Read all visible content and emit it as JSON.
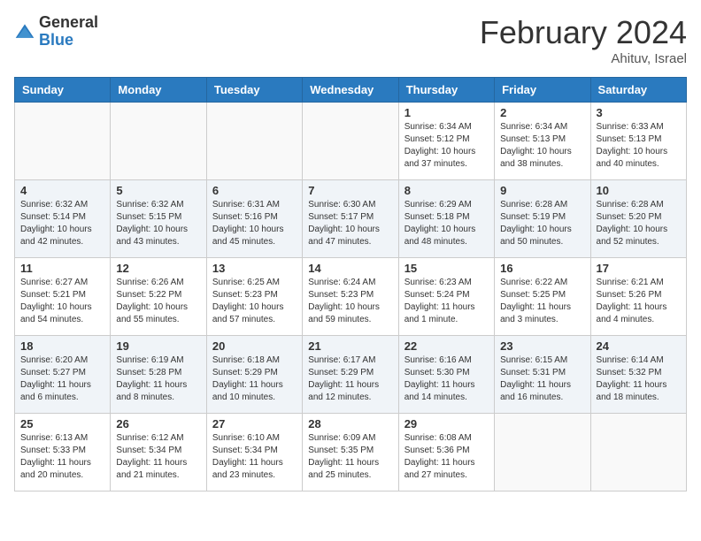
{
  "logo": {
    "general": "General",
    "blue": "Blue"
  },
  "title": "February 2024",
  "location": "Ahituv, Israel",
  "headers": [
    "Sunday",
    "Monday",
    "Tuesday",
    "Wednesday",
    "Thursday",
    "Friday",
    "Saturday"
  ],
  "weeks": [
    [
      {
        "day": "",
        "info": ""
      },
      {
        "day": "",
        "info": ""
      },
      {
        "day": "",
        "info": ""
      },
      {
        "day": "",
        "info": ""
      },
      {
        "day": "1",
        "info": "Sunrise: 6:34 AM\nSunset: 5:12 PM\nDaylight: 10 hours\nand 37 minutes."
      },
      {
        "day": "2",
        "info": "Sunrise: 6:34 AM\nSunset: 5:13 PM\nDaylight: 10 hours\nand 38 minutes."
      },
      {
        "day": "3",
        "info": "Sunrise: 6:33 AM\nSunset: 5:13 PM\nDaylight: 10 hours\nand 40 minutes."
      }
    ],
    [
      {
        "day": "4",
        "info": "Sunrise: 6:32 AM\nSunset: 5:14 PM\nDaylight: 10 hours\nand 42 minutes."
      },
      {
        "day": "5",
        "info": "Sunrise: 6:32 AM\nSunset: 5:15 PM\nDaylight: 10 hours\nand 43 minutes."
      },
      {
        "day": "6",
        "info": "Sunrise: 6:31 AM\nSunset: 5:16 PM\nDaylight: 10 hours\nand 45 minutes."
      },
      {
        "day": "7",
        "info": "Sunrise: 6:30 AM\nSunset: 5:17 PM\nDaylight: 10 hours\nand 47 minutes."
      },
      {
        "day": "8",
        "info": "Sunrise: 6:29 AM\nSunset: 5:18 PM\nDaylight: 10 hours\nand 48 minutes."
      },
      {
        "day": "9",
        "info": "Sunrise: 6:28 AM\nSunset: 5:19 PM\nDaylight: 10 hours\nand 50 minutes."
      },
      {
        "day": "10",
        "info": "Sunrise: 6:28 AM\nSunset: 5:20 PM\nDaylight: 10 hours\nand 52 minutes."
      }
    ],
    [
      {
        "day": "11",
        "info": "Sunrise: 6:27 AM\nSunset: 5:21 PM\nDaylight: 10 hours\nand 54 minutes."
      },
      {
        "day": "12",
        "info": "Sunrise: 6:26 AM\nSunset: 5:22 PM\nDaylight: 10 hours\nand 55 minutes."
      },
      {
        "day": "13",
        "info": "Sunrise: 6:25 AM\nSunset: 5:23 PM\nDaylight: 10 hours\nand 57 minutes."
      },
      {
        "day": "14",
        "info": "Sunrise: 6:24 AM\nSunset: 5:23 PM\nDaylight: 10 hours\nand 59 minutes."
      },
      {
        "day": "15",
        "info": "Sunrise: 6:23 AM\nSunset: 5:24 PM\nDaylight: 11 hours\nand 1 minute."
      },
      {
        "day": "16",
        "info": "Sunrise: 6:22 AM\nSunset: 5:25 PM\nDaylight: 11 hours\nand 3 minutes."
      },
      {
        "day": "17",
        "info": "Sunrise: 6:21 AM\nSunset: 5:26 PM\nDaylight: 11 hours\nand 4 minutes."
      }
    ],
    [
      {
        "day": "18",
        "info": "Sunrise: 6:20 AM\nSunset: 5:27 PM\nDaylight: 11 hours\nand 6 minutes."
      },
      {
        "day": "19",
        "info": "Sunrise: 6:19 AM\nSunset: 5:28 PM\nDaylight: 11 hours\nand 8 minutes."
      },
      {
        "day": "20",
        "info": "Sunrise: 6:18 AM\nSunset: 5:29 PM\nDaylight: 11 hours\nand 10 minutes."
      },
      {
        "day": "21",
        "info": "Sunrise: 6:17 AM\nSunset: 5:29 PM\nDaylight: 11 hours\nand 12 minutes."
      },
      {
        "day": "22",
        "info": "Sunrise: 6:16 AM\nSunset: 5:30 PM\nDaylight: 11 hours\nand 14 minutes."
      },
      {
        "day": "23",
        "info": "Sunrise: 6:15 AM\nSunset: 5:31 PM\nDaylight: 11 hours\nand 16 minutes."
      },
      {
        "day": "24",
        "info": "Sunrise: 6:14 AM\nSunset: 5:32 PM\nDaylight: 11 hours\nand 18 minutes."
      }
    ],
    [
      {
        "day": "25",
        "info": "Sunrise: 6:13 AM\nSunset: 5:33 PM\nDaylight: 11 hours\nand 20 minutes."
      },
      {
        "day": "26",
        "info": "Sunrise: 6:12 AM\nSunset: 5:34 PM\nDaylight: 11 hours\nand 21 minutes."
      },
      {
        "day": "27",
        "info": "Sunrise: 6:10 AM\nSunset: 5:34 PM\nDaylight: 11 hours\nand 23 minutes."
      },
      {
        "day": "28",
        "info": "Sunrise: 6:09 AM\nSunset: 5:35 PM\nDaylight: 11 hours\nand 25 minutes."
      },
      {
        "day": "29",
        "info": "Sunrise: 6:08 AM\nSunset: 5:36 PM\nDaylight: 11 hours\nand 27 minutes."
      },
      {
        "day": "",
        "info": ""
      },
      {
        "day": "",
        "info": ""
      }
    ]
  ]
}
